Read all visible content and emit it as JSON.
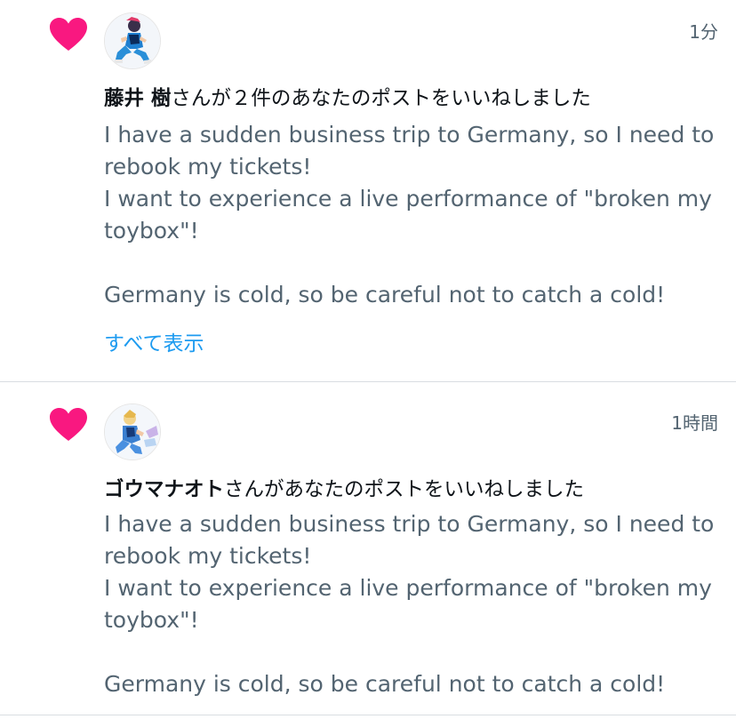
{
  "colors": {
    "heart": "#f91880",
    "link": "#1d9bf0",
    "secondary_text": "#536471",
    "primary_text": "#0f1419",
    "divider": "#d9dde1"
  },
  "notifications": [
    {
      "icon": "heart-icon",
      "timestamp": "1分",
      "user_name": "藤井 樹",
      "action_text": "さんが２件のあなたのポストをいいねしました",
      "post_text": "I have a sudden business trip to Germany, so I need to rebook my tickets!\nI want to experience a live performance of \"broken my toybox\"!\n\nGermany is cold, so be careful not to catch a cold!",
      "show_all_label": "すべて表示"
    },
    {
      "icon": "heart-icon",
      "timestamp": "1時間",
      "user_name": "ゴウマナオト",
      "action_text": "さんがあなたのポストをいいねしました",
      "post_text": "I have a sudden business trip to Germany, so I need to rebook my tickets!\nI want to experience a live performance of \"broken my toybox\"!\n\nGermany is cold, so be careful not to catch a cold!"
    }
  ]
}
